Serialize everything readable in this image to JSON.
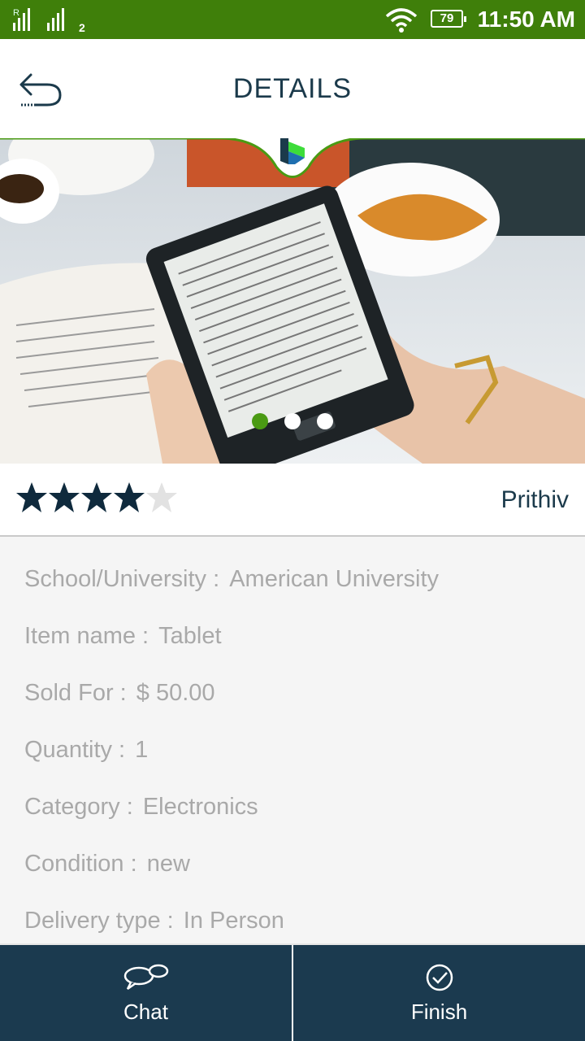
{
  "status_bar": {
    "sim2_label": "2",
    "battery_level": "79",
    "time": "11:50 AM"
  },
  "header": {
    "title": "DETAILS"
  },
  "carousel": {
    "image_count": 3,
    "active_index": 0,
    "accent_color": "#4a9a13"
  },
  "listing": {
    "rating": 4,
    "rating_max": 5,
    "seller": "Prithiv",
    "fields": [
      {
        "label": "School/University : ",
        "value": "American University"
      },
      {
        "label": "Item name : ",
        "value": "Tablet"
      },
      {
        "label": "Sold For : ",
        "value": " $ 50.00"
      },
      {
        "label": "Quantity : ",
        "value": "1"
      },
      {
        "label": "Category : ",
        "value": "Electronics"
      },
      {
        "label": "Condition : ",
        "value": "new"
      },
      {
        "label": "Delivery type : ",
        "value": "In Person"
      }
    ]
  },
  "bottom_bar": {
    "chat_label": "Chat",
    "finish_label": "Finish"
  },
  "colors": {
    "status_bar": "#3f7f0a",
    "primary_dark": "#1b3a4f",
    "text_muted": "#a9a9a9"
  }
}
